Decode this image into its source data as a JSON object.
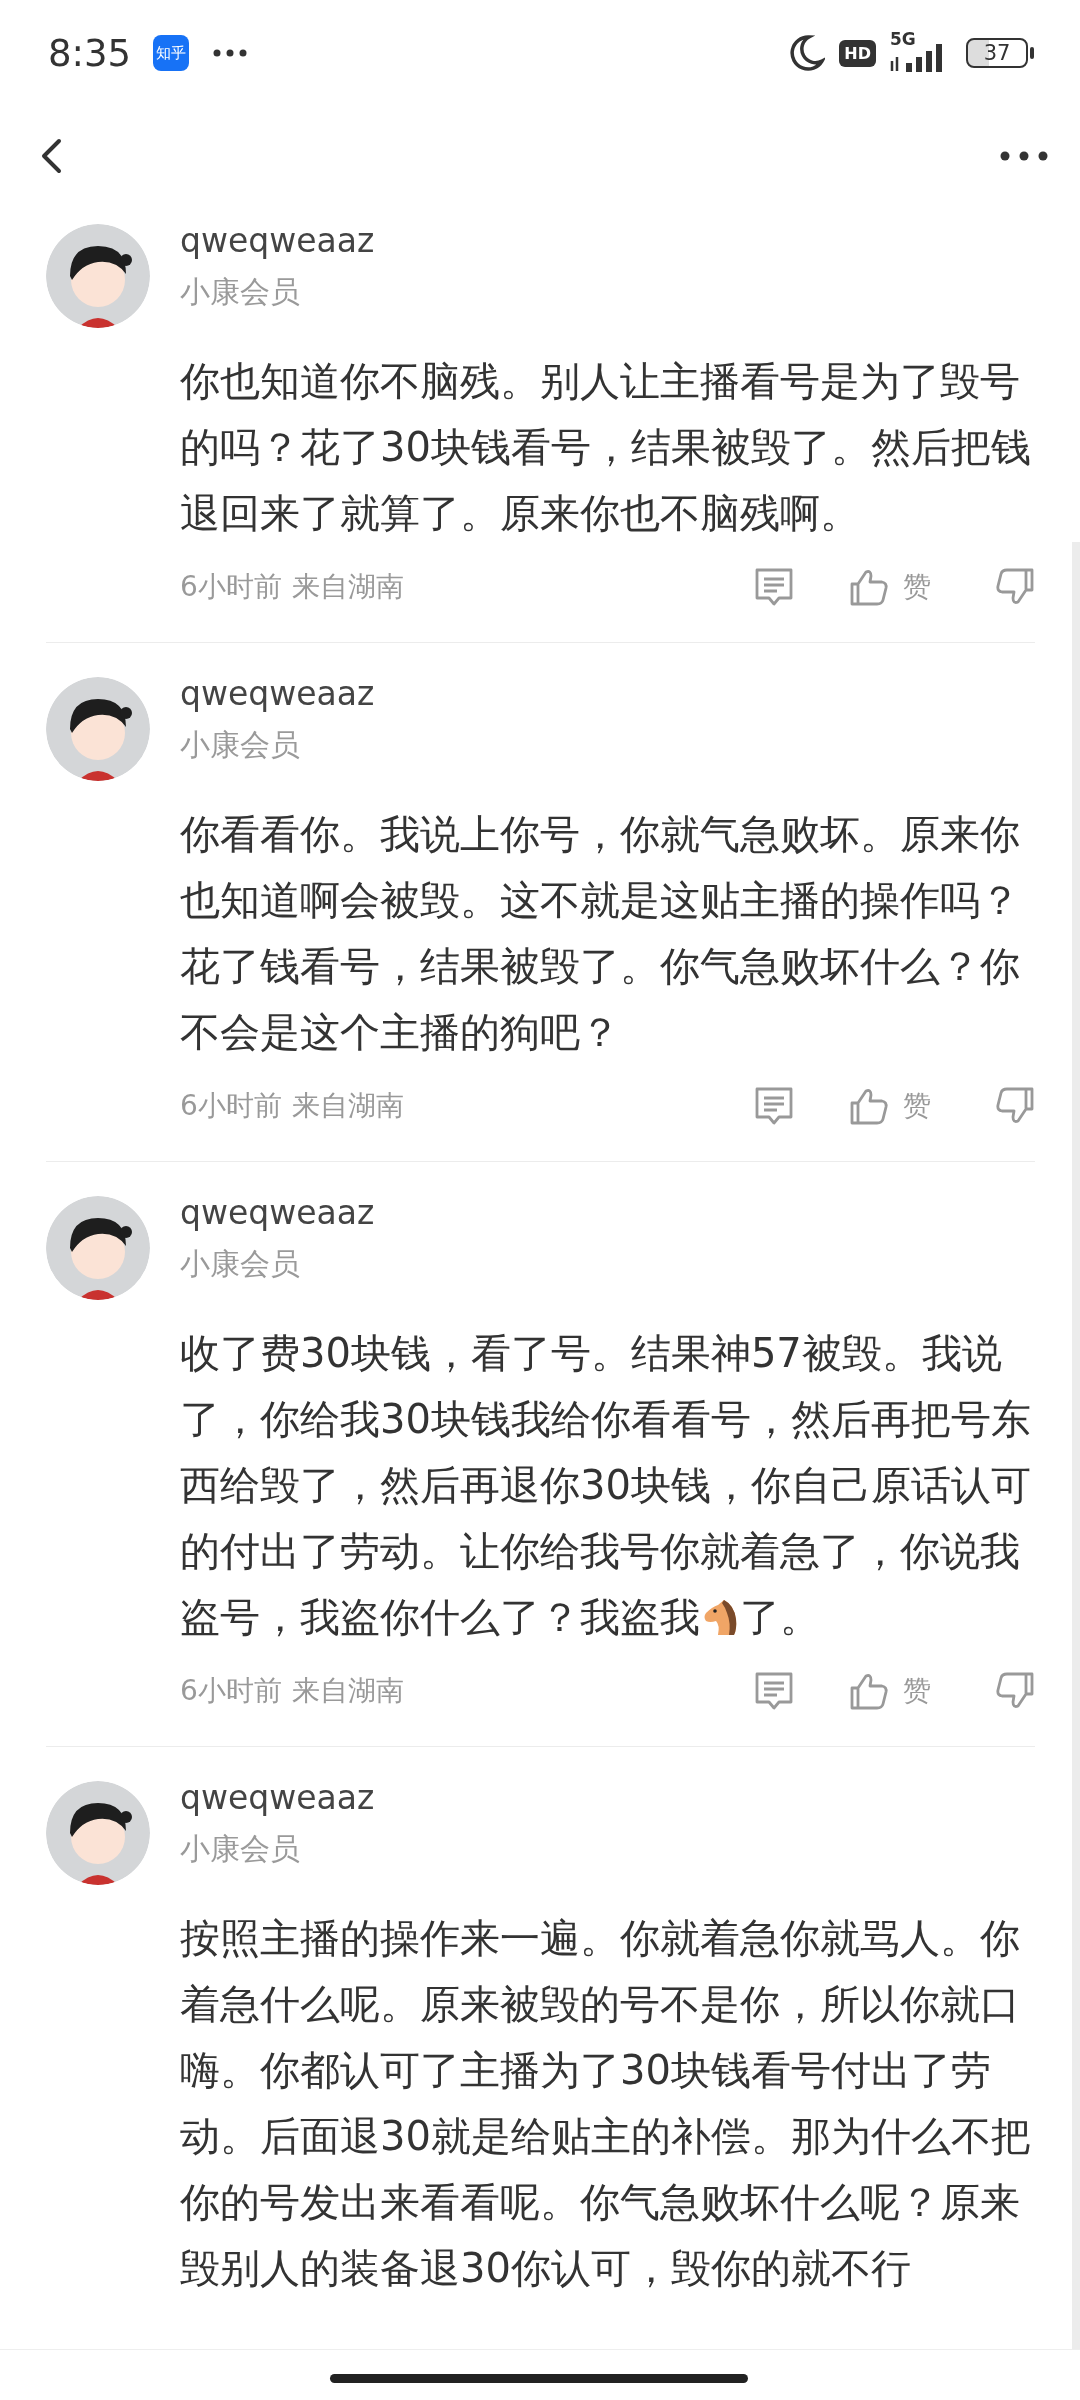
{
  "status_bar": {
    "time": "8:35",
    "app_badge": "知乎",
    "hd": "HD",
    "network": "5G",
    "battery": "37"
  },
  "comments": [
    {
      "user": "qweqweaaz",
      "badge": "小康会员",
      "body": [
        {
          "kind": "text",
          "text": "你也知道你不脑残。别人让主播看号是为了毁号的吗？花了30块钱看号，结果被毁了。然后把钱退回来了就算了。原来你也不脑残啊。"
        }
      ],
      "time": "6小时前",
      "location": "来自湖南",
      "like_label": "赞"
    },
    {
      "user": "qweqweaaz",
      "badge": "小康会员",
      "body": [
        {
          "kind": "text",
          "text": "你看看你。我说上你号，你就气急败坏。原来你也知道啊会被毁。这不就是这贴主播的操作吗？花了钱看号，结果被毁了。你气急败坏什么？你不会是这个主播的狗吧？"
        }
      ],
      "time": "6小时前",
      "location": "来自湖南",
      "like_label": "赞"
    },
    {
      "user": "qweqweaaz",
      "badge": "小康会员",
      "body": [
        {
          "kind": "text",
          "text": "收了费30块钱，看了号。结果神57被毁。我说了，你给我30块钱我给你看看号，然后再把号东西给毁了，然后再退你30块钱，你自己原话认可的付出了劳动。让你给我号你就着急了，你说我盗号，我盗你什么了？我盗我"
        },
        {
          "kind": "emoji"
        },
        {
          "kind": "text",
          "text": "了。"
        }
      ],
      "time": "6小时前",
      "location": "来自湖南",
      "like_label": "赞"
    },
    {
      "user": "qweqweaaz",
      "badge": "小康会员",
      "body": [
        {
          "kind": "text",
          "text": "按照主播的操作来一遍。你就着急你就骂人。你着急什么呢。原来被毁的号不是你，所以你就口嗨。你都认可了主播为了30块钱看号付出了劳动。后面退30就是给贴主的补偿。那为什么不把你的号发出来看看呢。你气急败坏什么呢？原来毁别人的装备退30你认可，毁你的就不行"
        }
      ]
    }
  ]
}
